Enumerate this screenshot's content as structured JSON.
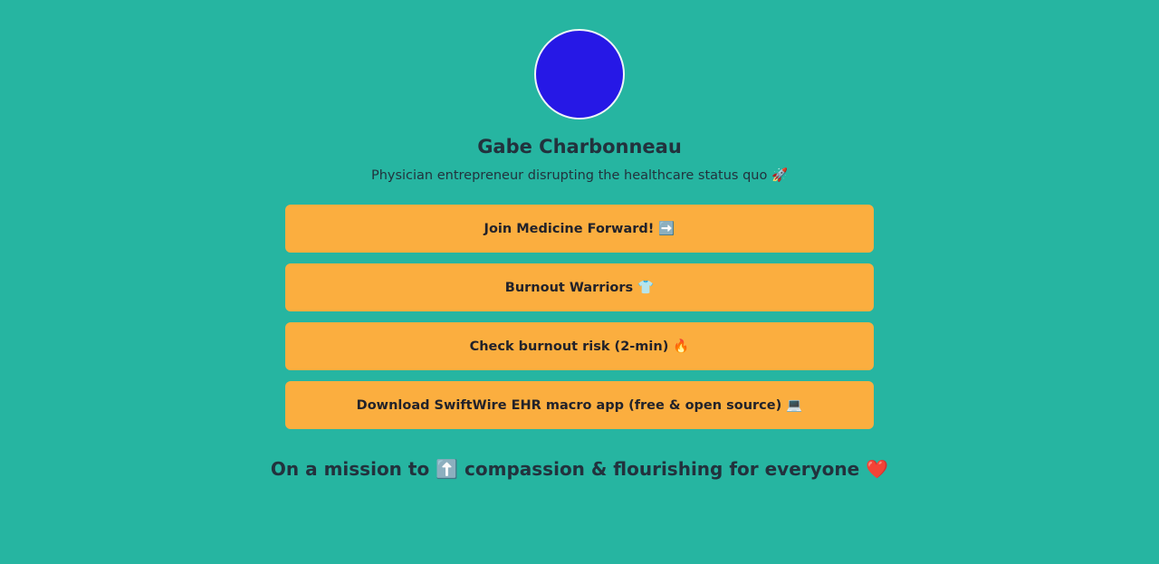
{
  "profile": {
    "name": "Gabe Charbonneau",
    "bio": "Physician entrepreneur disrupting the healthcare status quo 🚀",
    "avatar_color": "#2618e6"
  },
  "links": [
    {
      "label": "Join Medicine Forward!",
      "emoji": "➡️"
    },
    {
      "label": "Burnout Warriors",
      "emoji": "👕"
    },
    {
      "label": "Check burnout risk (2-min)",
      "emoji": "🔥"
    },
    {
      "label": "Download SwiftWire EHR macro app (free & open source)",
      "emoji": "💻"
    }
  ],
  "mission": {
    "prefix": "On a mission to",
    "arrow_emoji": "⬆️",
    "suffix": "compassion & flourishing for everyone",
    "heart_emoji": "❤️"
  },
  "colors": {
    "background": "#26b5a1",
    "button": "#fbae3f",
    "text": "#22323d"
  }
}
